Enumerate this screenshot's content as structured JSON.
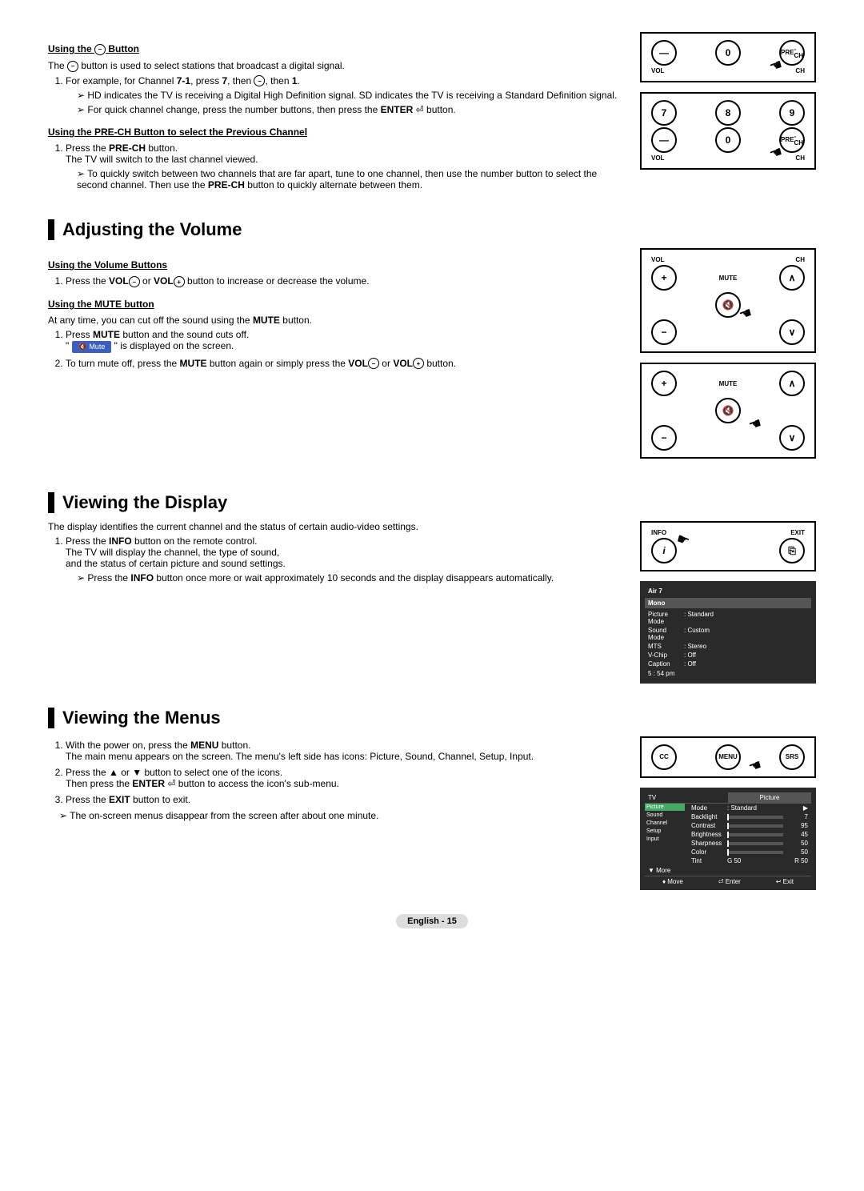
{
  "sections": {
    "dashbtn": {
      "heading_prefix": "Using the ",
      "heading_suffix": " Button",
      "intro_prefix": "The ",
      "intro_suffix": " button is used to select stations that broadcast a digital signal.",
      "step1_a": "For example, for Channel ",
      "step1_channel": "7-1",
      "step1_b": ", press ",
      "step1_press1": "7",
      "step1_c": ", then ",
      "step1_d": ", then ",
      "step1_press2": "1",
      "arrow1": "HD indicates the TV is receiving a Digital High Definition signal. SD indicates the TV is receiving a Standard Definition signal.",
      "arrow2_a": "For quick channel change, press the number buttons, then press the ",
      "arrow2_b": "ENTER",
      "arrow2_c": " button."
    },
    "prech": {
      "heading": "Using the PRE-CH Button to select the Previous Channel",
      "step1_a": "Press the ",
      "step1_b": "PRE-CH",
      "step1_c": " button.",
      "step1_line2": "The TV will switch to the last channel viewed.",
      "arrow1_a": "To quickly switch between two channels that are far apart, tune to one channel, then use the number button to select the second channel. Then use the ",
      "arrow1_b": "PRE-CH",
      "arrow1_c": " button to quickly alternate between them."
    },
    "volume": {
      "title": "Adjusting the Volume",
      "sub1": "Using the Volume Buttons",
      "s1_a": "Press the ",
      "s1_b": "VOL",
      "s1_c": " or ",
      "s1_d": "VOL",
      "s1_e": " button to increase or decrease the volume.",
      "sub2": "Using the MUTE button",
      "intro2_a": "At any time, you can cut off the sound using the ",
      "intro2_b": "MUTE",
      "intro2_c": " button.",
      "m1_a": "Press ",
      "m1_b": "MUTE",
      "m1_c": " button and the sound cuts off.",
      "m1_d": "\" ",
      "m1_e": " \" is displayed on the screen.",
      "mute_label": "Mute",
      "m2_a": "To turn mute off, press the ",
      "m2_b": "MUTE",
      "m2_c": " button again or simply press the ",
      "m2_d": "VOL",
      "m2_e": " or ",
      "m2_f": "VOL",
      "m2_g": " button."
    },
    "display": {
      "title": "Viewing the Display",
      "intro": "The display identifies the current channel and the status of certain audio-video settings.",
      "s1_a": "Press the ",
      "s1_b": "INFO",
      "s1_c": " button on the remote control.",
      "s1_line2": "The TV will display the channel, the type of sound,",
      "s1_line3": "and the status of certain picture and sound settings.",
      "arrow_a": "Press the ",
      "arrow_b": "INFO",
      "arrow_c": " button once more or wait approximately 10 seconds and the display disappears automatically."
    },
    "menus": {
      "title": "Viewing the Menus",
      "s1_a": "With the power on, press the ",
      "s1_b": "MENU",
      "s1_c": " button.",
      "s1_line2": "The main menu appears on the screen. The menu's left side has icons: Picture, Sound, Channel, Setup, Input.",
      "s2_a": "Press the ▲ or ▼ button to select one of the icons.",
      "s2_b": "Then press the ",
      "s2_c": "ENTER",
      "s2_d": " button to access the icon's sub-menu.",
      "s3_a": "Press the ",
      "s3_b": "EXIT",
      "s3_c": " button to exit.",
      "note": "The on-screen menus disappear from the screen after about one minute."
    }
  },
  "remote": {
    "num7": "7",
    "num8": "8",
    "num9": "9",
    "num0": "0",
    "dash": "—",
    "prech_top": "PRE",
    "prech_bot": "-CH",
    "vol_label": "VOL",
    "ch_label": "CH",
    "mute_label": "MUTE",
    "plus": "+",
    "minus": "−",
    "up": "∧",
    "down": "∨",
    "info": "INFO",
    "exit": "EXIT",
    "menu": "MENU",
    "cc": "CC",
    "srs": "SRS",
    "i": "i"
  },
  "osd_info": {
    "channel": "Air 7",
    "sound": "Mono",
    "rows": [
      {
        "l": "Picture Mode",
        "v": ": Standard"
      },
      {
        "l": "Sound Mode",
        "v": ": Custom"
      },
      {
        "l": "MTS",
        "v": ": Stereo"
      },
      {
        "l": "V-Chip",
        "v": ": Off"
      },
      {
        "l": "Caption",
        "v": ": Off"
      }
    ],
    "time": "5 : 54 pm"
  },
  "osd_menu": {
    "tab_left": "TV",
    "tab_right": "Picture",
    "left_items": [
      "Picture",
      "Sound",
      "Channel",
      "Setup",
      "Input"
    ],
    "rows": [
      {
        "l": "Mode",
        "v": ": Standard",
        "r": "▶"
      },
      {
        "l": "Backlight",
        "v": "",
        "r": "7"
      },
      {
        "l": "Contrast",
        "v": "",
        "r": "95"
      },
      {
        "l": "Brightness",
        "v": "",
        "r": "45"
      },
      {
        "l": "Sharpness",
        "v": "",
        "r": "50"
      },
      {
        "l": "Color",
        "v": "",
        "r": "50"
      },
      {
        "l": "Tint",
        "v": "G 50",
        "r": "R 50"
      }
    ],
    "more": "▼ More",
    "footer_move": "Move",
    "footer_enter": "Enter",
    "footer_exit": "Exit"
  },
  "footer": {
    "lang": "English - 15"
  }
}
